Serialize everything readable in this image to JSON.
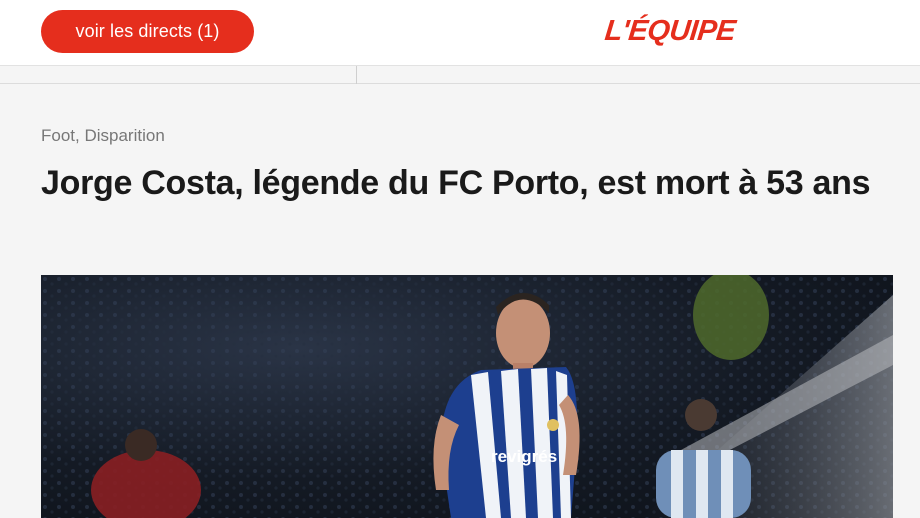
{
  "header": {
    "live_button_label": "voir les directs (1)",
    "logo_text": "L'ÉQUIPE"
  },
  "article": {
    "kicker": "Foot, Disparition",
    "title": "Jorge Costa, légende du FC Porto, est mort à 53 ans",
    "photo_shirt_text": "revigrés"
  },
  "colors": {
    "brand_red": "#e52e1d",
    "headline": "#1a1a1a",
    "kicker": "#777777"
  }
}
